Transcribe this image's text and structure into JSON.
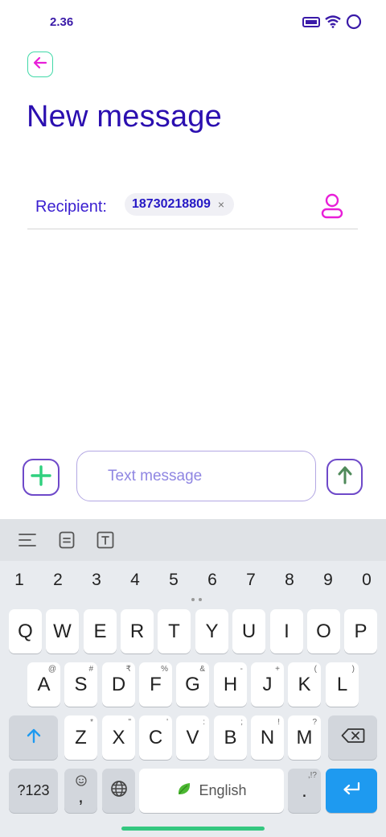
{
  "status": {
    "time": "2.36"
  },
  "header": {
    "title": "New message"
  },
  "recipient": {
    "label": "Recipient:",
    "chip": "18730218809",
    "chip_close": "×"
  },
  "compose": {
    "placeholder": "Text message"
  },
  "keyboard": {
    "numbers": [
      "1",
      "2",
      "3",
      "4",
      "5",
      "6",
      "7",
      "8",
      "9",
      "0"
    ],
    "row1": [
      "Q",
      "W",
      "E",
      "R",
      "T",
      "Y",
      "U",
      "I",
      "O",
      "P"
    ],
    "row2": [
      {
        "key": "A",
        "hint": "@"
      },
      {
        "key": "S",
        "hint": "#"
      },
      {
        "key": "D",
        "hint": "₹"
      },
      {
        "key": "F",
        "hint": "%"
      },
      {
        "key": "G",
        "hint": "&"
      },
      {
        "key": "H",
        "hint": "-"
      },
      {
        "key": "J",
        "hint": "+"
      },
      {
        "key": "K",
        "hint": "("
      },
      {
        "key": "L",
        "hint": ")"
      }
    ],
    "row3": [
      {
        "key": "Z",
        "hint": "*"
      },
      {
        "key": "X",
        "hint": "\""
      },
      {
        "key": "C",
        "hint": "'"
      },
      {
        "key": "V",
        "hint": ":"
      },
      {
        "key": "B",
        "hint": ";"
      },
      {
        "key": "N",
        "hint": "!"
      },
      {
        "key": "M",
        "hint": "?"
      }
    ],
    "symbols_label": "?123",
    "comma": ",",
    "space_label": "English",
    "period": ".",
    "period_hint": ",!?"
  },
  "colors": {
    "title": "#2b0fb0",
    "accent_purple": "#6e49c9",
    "accent_green": "#2fd07e",
    "accent_magenta": "#e81fd8",
    "key_blue": "#1e9af0"
  }
}
